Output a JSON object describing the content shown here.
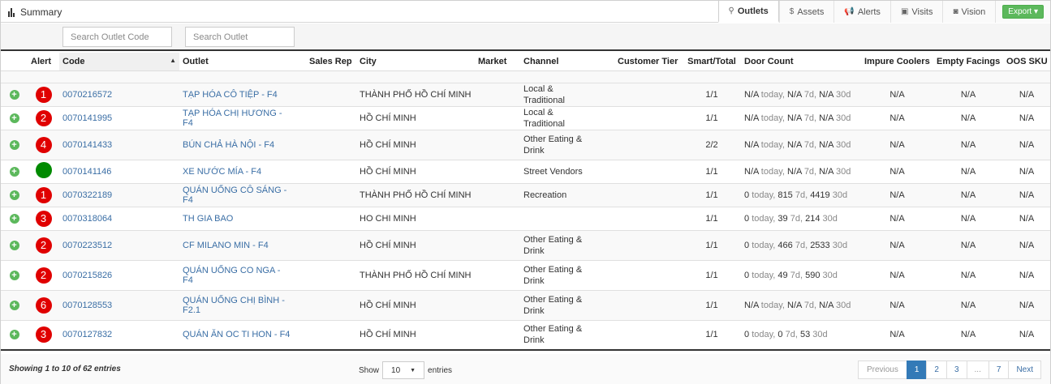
{
  "header": {
    "title": "Summary",
    "tabs": [
      {
        "label": "Outlets",
        "icon": "map-marker-icon",
        "glyph": "⚲",
        "active": true
      },
      {
        "label": "Assets",
        "icon": "dollar-icon",
        "glyph": "$",
        "active": false
      },
      {
        "label": "Alerts",
        "icon": "bullhorn-icon",
        "glyph": "📢",
        "active": false
      },
      {
        "label": "Visits",
        "icon": "briefcase-icon",
        "glyph": "▣",
        "active": false
      },
      {
        "label": "Vision",
        "icon": "camera-icon",
        "glyph": "◙",
        "active": false
      }
    ],
    "export_label": "Export ▾"
  },
  "search": {
    "code_placeholder": "Search Outlet Code",
    "outlet_placeholder": "Search Outlet"
  },
  "table": {
    "headers": [
      "",
      "Alert",
      "Code",
      "Outlet",
      "Sales Rep",
      "City",
      "Market",
      "Channel",
      "Customer Tier",
      "Smart/Total",
      "Door Count",
      "Impure Coolers",
      "Empty Facings",
      "OOS SKU"
    ],
    "rows": [
      {
        "alert": "1",
        "alert_color": "#e00000",
        "code": "0070216572",
        "outlet": "TẠP HÓA CÔ TIỆP - F4",
        "sales_rep": "",
        "city": "THÀNH PHỐ HỒ CHÍ MINH",
        "market": "",
        "channel": "Local & Traditional",
        "tier": "",
        "smart_total": "1/1",
        "dc": [
          "N/A",
          "today,",
          "N/A",
          "7d,",
          "N/A",
          "30d"
        ],
        "impure": "N/A",
        "empty": "N/A",
        "oos": "N/A"
      },
      {
        "alert": "2",
        "alert_color": "#e00000",
        "code": "0070141995",
        "outlet": "TẠP HÓA CHỊ HƯƠNG - F4",
        "sales_rep": "",
        "city": "HỒ CHÍ MINH",
        "market": "",
        "channel": "Local & Traditional",
        "tier": "",
        "smart_total": "1/1",
        "dc": [
          "N/A",
          "today,",
          "N/A",
          "7d,",
          "N/A",
          "30d"
        ],
        "impure": "N/A",
        "empty": "N/A",
        "oos": "N/A"
      },
      {
        "alert": "4",
        "alert_color": "#e00000",
        "code": "0070141433",
        "outlet": "BÚN CHẢ HÀ NỘI - F4",
        "sales_rep": "",
        "city": "HỒ CHÍ MINH",
        "market": "",
        "channel": "Other Eating & Drink",
        "tier": "",
        "smart_total": "2/2",
        "dc": [
          "N/A",
          "today,",
          "N/A",
          "7d,",
          "N/A",
          "30d"
        ],
        "impure": "N/A",
        "empty": "N/A",
        "oos": "N/A"
      },
      {
        "alert": "",
        "alert_color": "#008a00",
        "code": "0070141146",
        "outlet": "XE NƯỚC MÍA - F4",
        "sales_rep": "",
        "city": "HỒ CHÍ MINH",
        "market": "",
        "channel": "Street Vendors",
        "tier": "",
        "smart_total": "1/1",
        "dc": [
          "N/A",
          "today,",
          "N/A",
          "7d,",
          "N/A",
          "30d"
        ],
        "impure": "N/A",
        "empty": "N/A",
        "oos": "N/A"
      },
      {
        "alert": "1",
        "alert_color": "#e00000",
        "code": "0070322189",
        "outlet": "QUÁN UỐNG CÔ SÁNG - F4",
        "sales_rep": "",
        "city": "THÀNH PHỐ HỒ CHÍ MINH",
        "market": "",
        "channel": "Recreation",
        "tier": "",
        "smart_total": "1/1",
        "dc": [
          "0",
          "today,",
          "815",
          "7d,",
          "4419",
          "30d"
        ],
        "impure": "N/A",
        "empty": "N/A",
        "oos": "N/A"
      },
      {
        "alert": "3",
        "alert_color": "#e00000",
        "code": "0070318064",
        "outlet": "TH GIA BAO",
        "sales_rep": "",
        "city": "HO CHI MINH",
        "market": "",
        "channel": "",
        "tier": "",
        "smart_total": "1/1",
        "dc": [
          "0",
          "today,",
          "39",
          "7d,",
          "214",
          "30d"
        ],
        "impure": "N/A",
        "empty": "N/A",
        "oos": "N/A"
      },
      {
        "alert": "2",
        "alert_color": "#e00000",
        "code": "0070223512",
        "outlet": "CF MILANO MIN - F4",
        "sales_rep": "",
        "city": "HỒ CHÍ MINH",
        "market": "",
        "channel": "Other Eating & Drink",
        "tier": "",
        "smart_total": "1/1",
        "dc": [
          "0",
          "today,",
          "466",
          "7d,",
          "2533",
          "30d"
        ],
        "impure": "N/A",
        "empty": "N/A",
        "oos": "N/A"
      },
      {
        "alert": "2",
        "alert_color": "#e00000",
        "code": "0070215826",
        "outlet": "QUÁN UỐNG CO NGA - F4",
        "sales_rep": "",
        "city": "THÀNH PHỐ HỒ CHÍ MINH",
        "market": "",
        "channel": "Other Eating & Drink",
        "tier": "",
        "smart_total": "1/1",
        "dc": [
          "0",
          "today,",
          "49",
          "7d,",
          "590",
          "30d"
        ],
        "impure": "N/A",
        "empty": "N/A",
        "oos": "N/A"
      },
      {
        "alert": "6",
        "alert_color": "#e00000",
        "code": "0070128553",
        "outlet": "QUÁN UỐNG CHỊ BÌNH - F2.1",
        "sales_rep": "",
        "city": "HỒ CHÍ MINH",
        "market": "",
        "channel": "Other Eating & Drink",
        "tier": "",
        "smart_total": "1/1",
        "dc": [
          "N/A",
          "today,",
          "N/A",
          "7d,",
          "N/A",
          "30d"
        ],
        "impure": "N/A",
        "empty": "N/A",
        "oos": "N/A"
      },
      {
        "alert": "3",
        "alert_color": "#e00000",
        "code": "0070127832",
        "outlet": "QUÁN ĂN OC TI HON - F4",
        "sales_rep": "",
        "city": "HỒ CHÍ MINH",
        "market": "",
        "channel": "Other Eating & Drink",
        "tier": "",
        "smart_total": "1/1",
        "dc": [
          "0",
          "today,",
          "0",
          "7d,",
          "53",
          "30d"
        ],
        "impure": "N/A",
        "empty": "N/A",
        "oos": "N/A"
      }
    ]
  },
  "footer": {
    "showing": "Showing 1 to 10 of 62 entries",
    "show_label": "Show",
    "page_length": "10",
    "entries_label": "entries",
    "pager": [
      "Previous",
      "1",
      "2",
      "3",
      "...",
      "7",
      "Next"
    ],
    "active_page": "1"
  },
  "colors": {
    "link": "#3a6ea5",
    "alert_red": "#e00000",
    "alert_green": "#008a00",
    "export_green": "#5cb85c",
    "pager_active": "#337ab7"
  }
}
